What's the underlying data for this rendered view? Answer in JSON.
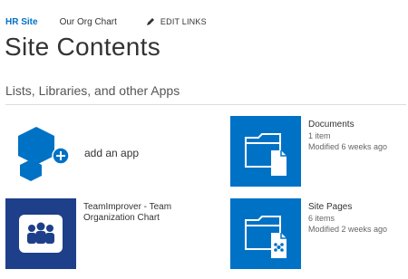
{
  "nav": {
    "site_title": "HR Site",
    "org_chart_link": "Our Org Chart",
    "edit_links": "EDIT LINKS"
  },
  "page": {
    "title": "Site Contents",
    "section_heading": "Lists, Libraries, and other Apps"
  },
  "tiles": {
    "add_app": {
      "label": "add an app"
    },
    "team_improver": {
      "title": "TeamImprover - Team Organization Chart"
    },
    "documents": {
      "title": "Documents",
      "count": "1 item",
      "modified": "Modified 6 weeks ago"
    },
    "site_pages": {
      "title": "Site Pages",
      "count": "6 items",
      "modified": "Modified 2 weeks ago"
    }
  },
  "colors": {
    "accent": "#0072c6",
    "team_tile": "#1e3f8a"
  },
  "icons": {
    "add_app": "add-app-icon",
    "team": "team-org-chart-icon",
    "documents": "document-library-icon",
    "site_pages": "page-library-icon",
    "edit": "pencil-icon"
  }
}
